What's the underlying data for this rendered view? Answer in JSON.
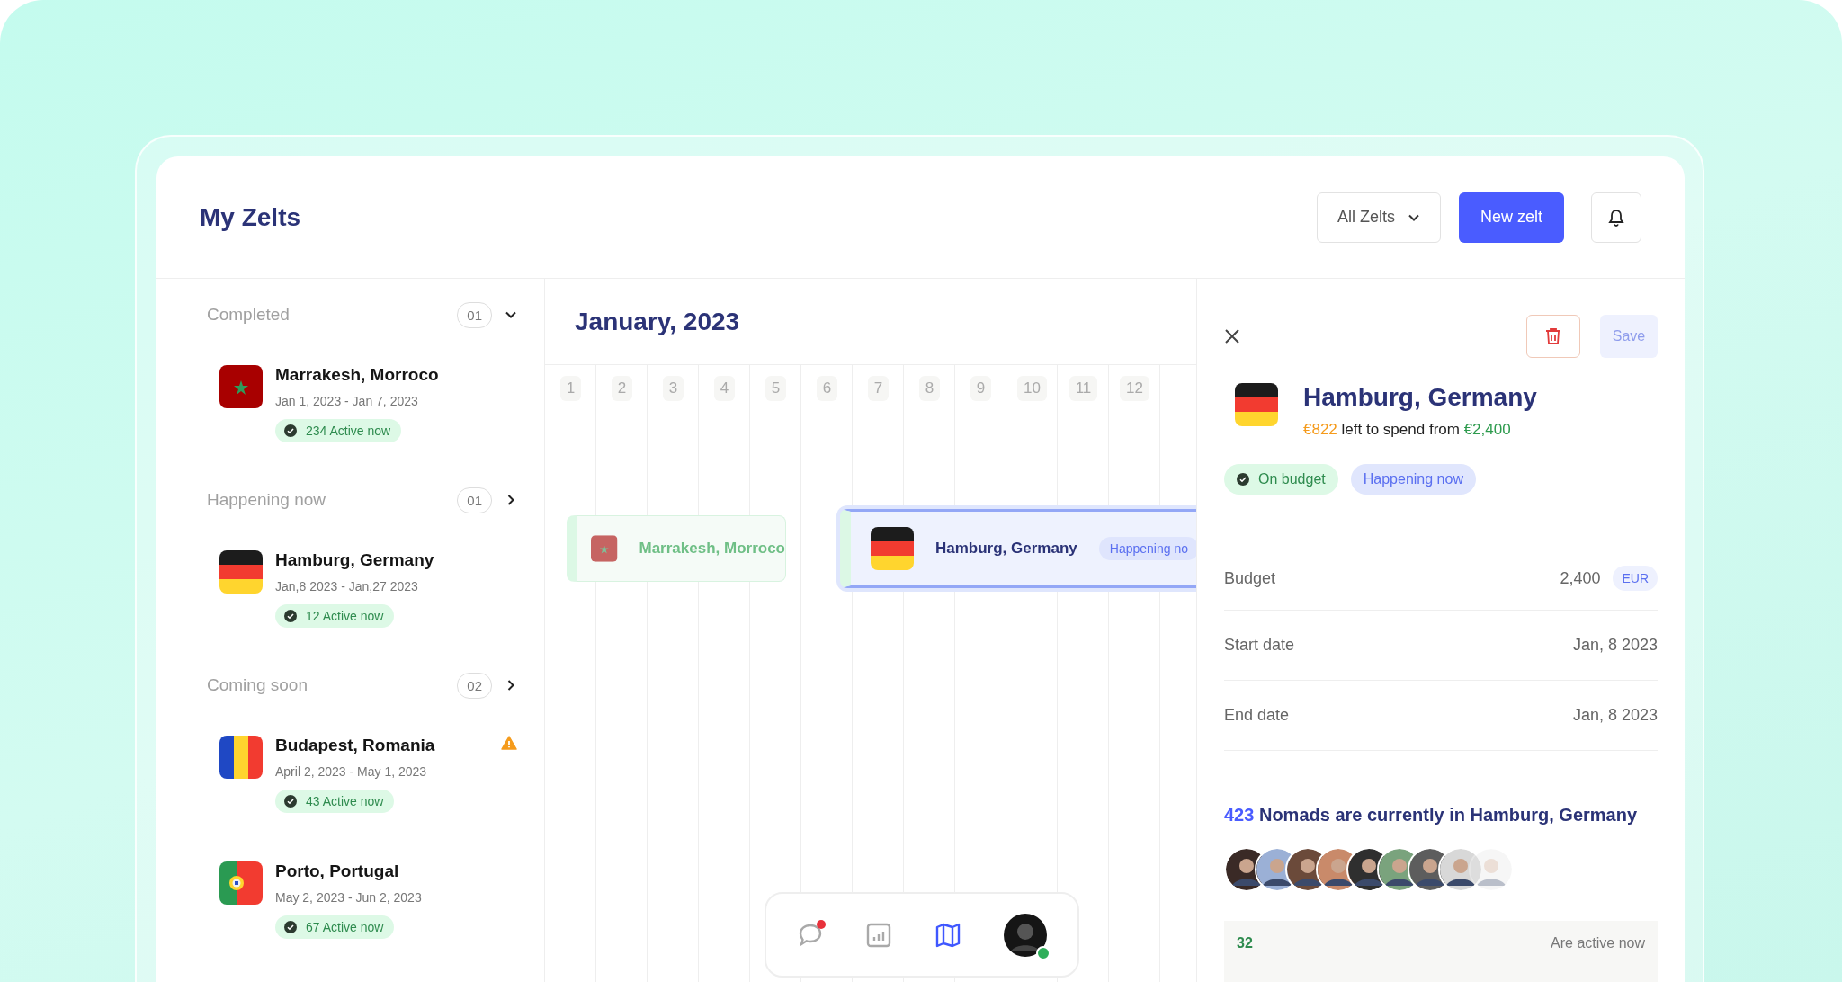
{
  "header": {
    "title": "My Zelts",
    "filter": "All Zelts",
    "new_button": "New zelt"
  },
  "sidebar": {
    "sections": [
      {
        "title": "Completed",
        "count": "01",
        "expanded": true,
        "items": [
          {
            "name": "Marrakesh, Morroco",
            "dates": "Jan 1, 2023 - Jan 7, 2023",
            "active": "234 Active now",
            "flag": {
              "kind": "morocco"
            },
            "warning": false
          }
        ]
      },
      {
        "title": "Happening now",
        "count": "01",
        "expanded": false,
        "items": [
          {
            "name": "Hamburg, Germany",
            "dates": "Jan,8 2023 - Jan,27 2023",
            "active": "12 Active now",
            "flag": {
              "kind": "germany"
            },
            "warning": false
          }
        ]
      },
      {
        "title": "Coming soon",
        "count": "02",
        "expanded": false,
        "items": [
          {
            "name": "Budapest, Romania",
            "dates": "April 2, 2023 - May 1, 2023",
            "active": "43 Active now",
            "flag": {
              "kind": "romania"
            },
            "warning": true
          },
          {
            "name": "Porto, Portugal",
            "dates": "May 2, 2023 - Jun 2, 2023",
            "active": "67 Active now",
            "flag": {
              "kind": "portugal"
            },
            "warning": false
          }
        ]
      }
    ]
  },
  "timeline": {
    "title": "January, 2023",
    "days": [
      "1",
      "2",
      "3",
      "4",
      "5",
      "6",
      "7",
      "8",
      "9",
      "10",
      "11",
      "12"
    ],
    "events": [
      {
        "name": "Marrakesh, Morroco",
        "flag": {
          "kind": "morocco"
        },
        "selected": false
      },
      {
        "name": "Hamburg, Germany",
        "flag": {
          "kind": "germany"
        },
        "selected": true,
        "tag": "Happening no"
      }
    ]
  },
  "detail": {
    "title": "Hamburg, Germany",
    "flag": {
      "kind": "germany"
    },
    "remaining": "€822",
    "spend_text": "left to spend from",
    "total": "€2,400",
    "save": {
      "label": "Save",
      "disabled": true
    },
    "tags": [
      {
        "label": "On budget",
        "kind": "success"
      },
      {
        "label": "Happening now",
        "kind": "info"
      }
    ],
    "fields": [
      {
        "label": "Budget",
        "value": "2,400",
        "unit": "EUR"
      },
      {
        "label": "Start date",
        "value": "Jan, 8 2023"
      },
      {
        "label": "End date",
        "value": "Jan, 8 2023"
      }
    ],
    "nomads_count": "423",
    "nomads_text": "Nomads are currently in Hamburg, Germany",
    "active_count": "32",
    "active_text": "Are active now"
  },
  "dock": [
    {
      "kind": "chat",
      "selected": false,
      "unread": true
    },
    {
      "kind": "chart",
      "selected": false
    },
    {
      "kind": "map",
      "selected": true
    },
    {
      "kind": "profile",
      "online": true
    }
  ]
}
